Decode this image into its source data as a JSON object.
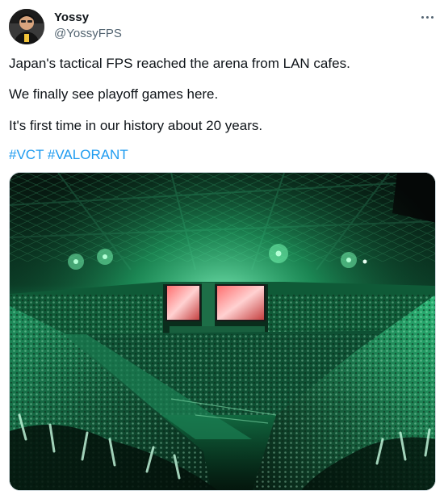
{
  "author": {
    "name": "Yossy",
    "handle": "@YossyFPS"
  },
  "tweet": {
    "lines": [
      "Japan's tactical FPS reached the arena from LAN cafes.",
      "We finally see playoff games here.",
      "It's first time in our history about 20 years."
    ],
    "hashtags": [
      "#VCT",
      "#VALORANT"
    ]
  },
  "icons": {
    "more": "more-options-icon"
  },
  "colors": {
    "link": "#1d9bf0",
    "text": "#0f1419",
    "secondary": "#536471",
    "arena_green": "#3dff9a"
  }
}
